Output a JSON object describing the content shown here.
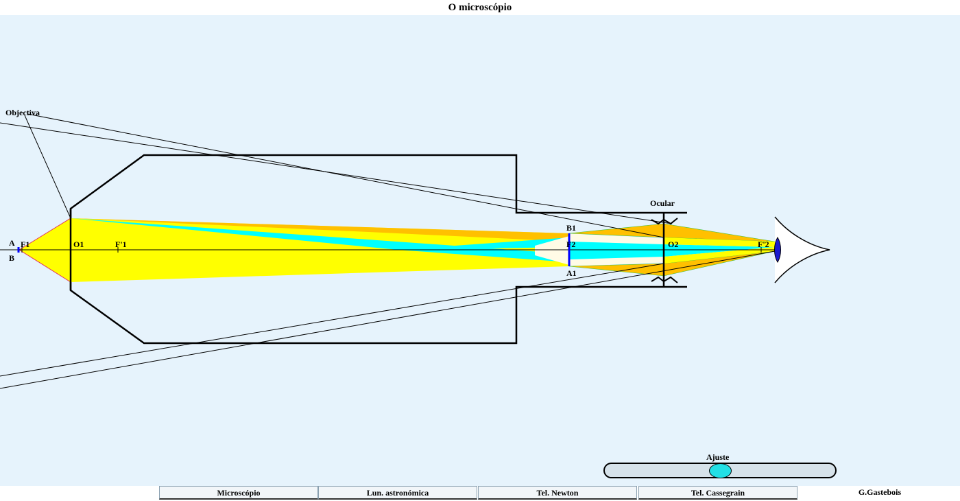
{
  "window": {
    "title": "O microscópio"
  },
  "labels": {
    "objectiva": "Objectiva",
    "ocular": "Ocular",
    "A": "A",
    "B": "B",
    "F1": "F1",
    "O1": "O1",
    "Fp1": "F'1",
    "B1": "B1",
    "F2": "F2",
    "A1": "A1",
    "O2": "O2",
    "Fp2": "F'2"
  },
  "slider": {
    "label": "Ajuste",
    "value_fraction": 0.5
  },
  "tabs": [
    {
      "label": "Microscópio"
    },
    {
      "label": "Lun. astronómica"
    },
    {
      "label": "Tel. Newton"
    },
    {
      "label": "Tel. Cassegrain"
    }
  ],
  "credit": "G.Gastebois",
  "colors": {
    "background": "#e6f3fc",
    "beam_yellow": "#ffff00",
    "beam_orange": "#ffc000",
    "beam_cyan": "#00ffff",
    "beam_white": "#fffbe6",
    "image_blue": "#0000ff",
    "slider_knob": "#22e0e6"
  }
}
